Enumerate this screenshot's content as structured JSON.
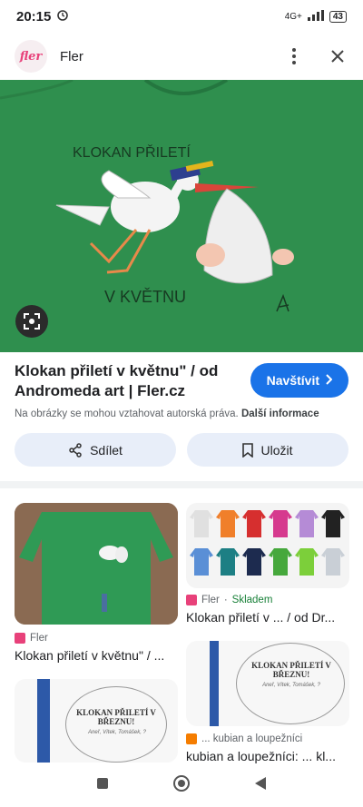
{
  "status": {
    "time": "20:15",
    "network": "4G+",
    "battery": "43"
  },
  "app_bar": {
    "logo_text": "fler",
    "title": "Fler"
  },
  "hero": {
    "text_top": "KLOKAN PŘILETÍ",
    "text_bottom": "V KVĚTNU",
    "shirt_color": "#2f8f4e"
  },
  "result": {
    "title": "Klokan přiletí v květnu\" / od Andromeda art | Fler.cz",
    "visit_label": "Navštívit",
    "copyright_text": "Na obrázky se mohou vztahovat autorská práva.",
    "more_info_label": "Další informace"
  },
  "actions": {
    "share_label": "Sdílet",
    "save_label": "Uložit"
  },
  "related": [
    {
      "source": "Fler",
      "title": "Klokan přiletí v květnu\" / ..."
    },
    {
      "source": "Fler",
      "stock": "Skladem",
      "title": "Klokan přiletí v ... / od Dr...",
      "swatches": [
        "#e0e0e0",
        "#f07f2a",
        "#d62f2f",
        "#d63a8e",
        "#b58bd6",
        "#222222",
        "#5a8fd6",
        "#1d7f84",
        "#1d2b4f",
        "#46a83c",
        "#7ccf3a",
        "#c9cfd6"
      ]
    },
    {
      "card_text": "KLOKAN PŘILETÍ V BŘEZNU!",
      "card_sub": "Aneř, Vítek, Tomášek, ?"
    },
    {
      "source": "... kubian a loupežníci",
      "title": "kubian a loupežníci: ... kl...",
      "card_text": "KLOKAN PŘILETÍ V BŘEZNU!",
      "card_sub": "Aneř, Vítek, Tomášek, ?"
    }
  ],
  "colors": {
    "accent": "#1a73e8",
    "fler_pink": "#e8417a",
    "stock_green": "#188038"
  }
}
